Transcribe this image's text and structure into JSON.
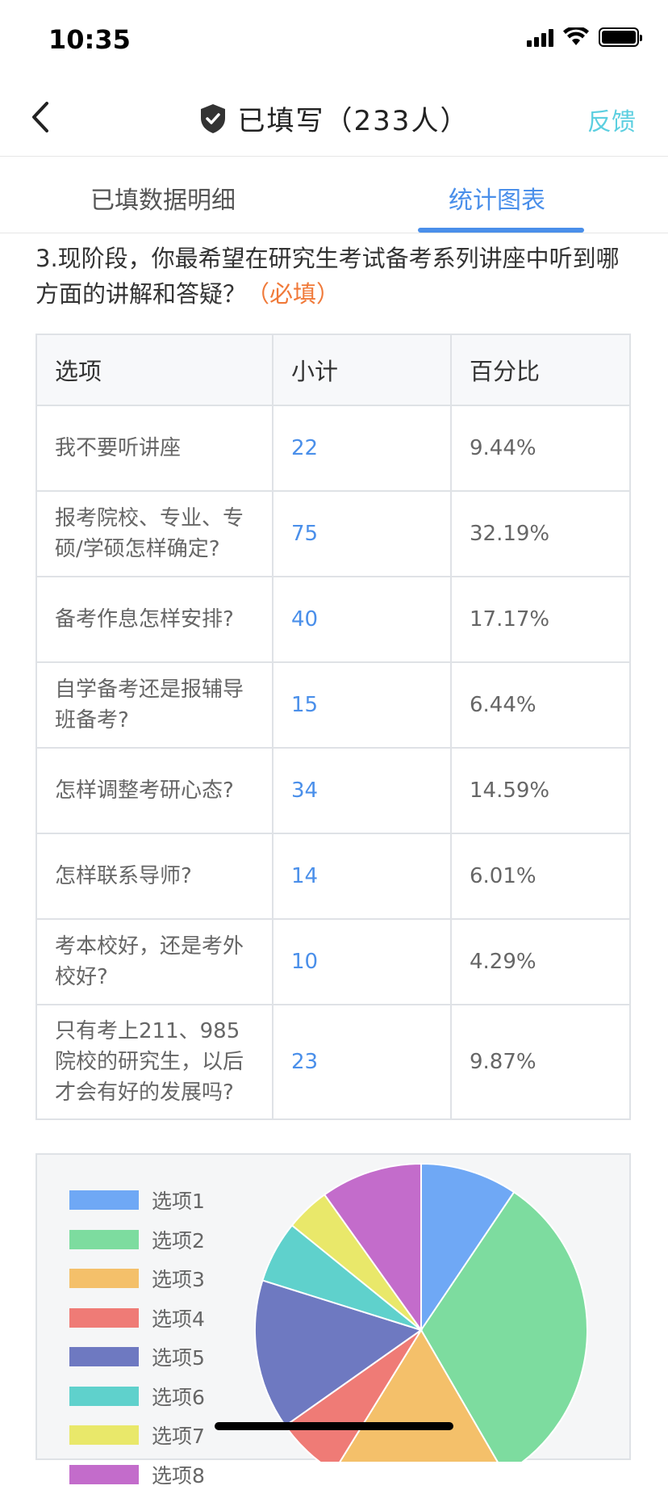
{
  "status_bar": {
    "time": "10:35"
  },
  "nav": {
    "title": "已填写（233人）",
    "feedback": "反馈"
  },
  "tabs": [
    {
      "label": "已填数据明细",
      "active": false
    },
    {
      "label": "统计图表",
      "active": true
    }
  ],
  "question": {
    "text": "3.现阶段，你最希望在研究生考试备考系列讲座中听到哪方面的讲解和答疑？",
    "required": "（必填）"
  },
  "table": {
    "headers": [
      "选项",
      "小计",
      "百分比"
    ],
    "rows": [
      {
        "option": "我不要听讲座",
        "count": "22",
        "percent": "9.44%"
      },
      {
        "option": "报考院校、专业、专硕/学硕怎样确定?",
        "count": "75",
        "percent": "32.19%"
      },
      {
        "option": "备考作息怎样安排?",
        "count": "40",
        "percent": "17.17%"
      },
      {
        "option": "自学备考还是报辅导班备考?",
        "count": "15",
        "percent": "6.44%"
      },
      {
        "option": "怎样调整考研心态?",
        "count": "34",
        "percent": "14.59%"
      },
      {
        "option": "怎样联系导师?",
        "count": "14",
        "percent": "6.01%"
      },
      {
        "option": "考本校好，还是考外校好?",
        "count": "10",
        "percent": "4.29%"
      },
      {
        "option": "只有考上211、985院校的研究生，以后才会有好的发展吗?",
        "count": "23",
        "percent": "9.87%"
      }
    ]
  },
  "chart_data": {
    "type": "pie",
    "categories": [
      "选项1",
      "选项2",
      "选项3",
      "选项4",
      "选项5",
      "选项6",
      "选项7",
      "选项8"
    ],
    "values": [
      22,
      75,
      40,
      15,
      34,
      14,
      10,
      23
    ],
    "colors": [
      "#6fa8f5",
      "#7ddc9f",
      "#f4c06a",
      "#ef7b76",
      "#6e79c1",
      "#5fd1cc",
      "#e9e86a",
      "#c36ccb"
    ],
    "legend_position": "left"
  }
}
